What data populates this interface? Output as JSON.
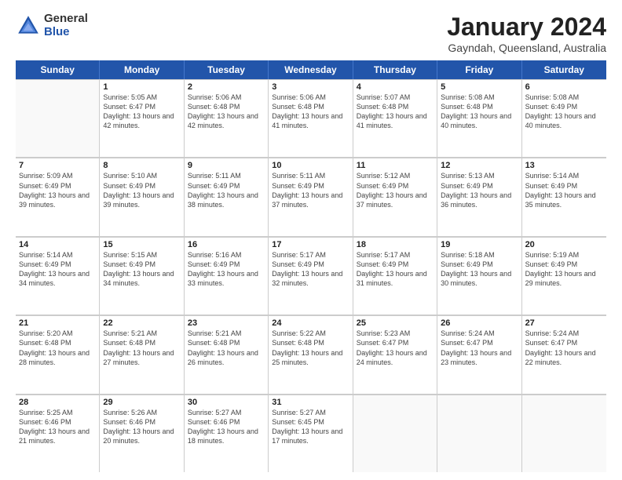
{
  "logo": {
    "general": "General",
    "blue": "Blue"
  },
  "header": {
    "title": "January 2024",
    "subtitle": "Gayndah, Queensland, Australia"
  },
  "days_of_week": [
    "Sunday",
    "Monday",
    "Tuesday",
    "Wednesday",
    "Thursday",
    "Friday",
    "Saturday"
  ],
  "weeks": [
    [
      {
        "day": "",
        "empty": true
      },
      {
        "day": "1",
        "sunrise": "Sunrise: 5:05 AM",
        "sunset": "Sunset: 6:47 PM",
        "daylight": "Daylight: 13 hours and 42 minutes."
      },
      {
        "day": "2",
        "sunrise": "Sunrise: 5:06 AM",
        "sunset": "Sunset: 6:48 PM",
        "daylight": "Daylight: 13 hours and 42 minutes."
      },
      {
        "day": "3",
        "sunrise": "Sunrise: 5:06 AM",
        "sunset": "Sunset: 6:48 PM",
        "daylight": "Daylight: 13 hours and 41 minutes."
      },
      {
        "day": "4",
        "sunrise": "Sunrise: 5:07 AM",
        "sunset": "Sunset: 6:48 PM",
        "daylight": "Daylight: 13 hours and 41 minutes."
      },
      {
        "day": "5",
        "sunrise": "Sunrise: 5:08 AM",
        "sunset": "Sunset: 6:48 PM",
        "daylight": "Daylight: 13 hours and 40 minutes."
      },
      {
        "day": "6",
        "sunrise": "Sunrise: 5:08 AM",
        "sunset": "Sunset: 6:49 PM",
        "daylight": "Daylight: 13 hours and 40 minutes."
      }
    ],
    [
      {
        "day": "7",
        "sunrise": "Sunrise: 5:09 AM",
        "sunset": "Sunset: 6:49 PM",
        "daylight": "Daylight: 13 hours and 39 minutes."
      },
      {
        "day": "8",
        "sunrise": "Sunrise: 5:10 AM",
        "sunset": "Sunset: 6:49 PM",
        "daylight": "Daylight: 13 hours and 39 minutes."
      },
      {
        "day": "9",
        "sunrise": "Sunrise: 5:11 AM",
        "sunset": "Sunset: 6:49 PM",
        "daylight": "Daylight: 13 hours and 38 minutes."
      },
      {
        "day": "10",
        "sunrise": "Sunrise: 5:11 AM",
        "sunset": "Sunset: 6:49 PM",
        "daylight": "Daylight: 13 hours and 37 minutes."
      },
      {
        "day": "11",
        "sunrise": "Sunrise: 5:12 AM",
        "sunset": "Sunset: 6:49 PM",
        "daylight": "Daylight: 13 hours and 37 minutes."
      },
      {
        "day": "12",
        "sunrise": "Sunrise: 5:13 AM",
        "sunset": "Sunset: 6:49 PM",
        "daylight": "Daylight: 13 hours and 36 minutes."
      },
      {
        "day": "13",
        "sunrise": "Sunrise: 5:14 AM",
        "sunset": "Sunset: 6:49 PM",
        "daylight": "Daylight: 13 hours and 35 minutes."
      }
    ],
    [
      {
        "day": "14",
        "sunrise": "Sunrise: 5:14 AM",
        "sunset": "Sunset: 6:49 PM",
        "daylight": "Daylight: 13 hours and 34 minutes."
      },
      {
        "day": "15",
        "sunrise": "Sunrise: 5:15 AM",
        "sunset": "Sunset: 6:49 PM",
        "daylight": "Daylight: 13 hours and 34 minutes."
      },
      {
        "day": "16",
        "sunrise": "Sunrise: 5:16 AM",
        "sunset": "Sunset: 6:49 PM",
        "daylight": "Daylight: 13 hours and 33 minutes."
      },
      {
        "day": "17",
        "sunrise": "Sunrise: 5:17 AM",
        "sunset": "Sunset: 6:49 PM",
        "daylight": "Daylight: 13 hours and 32 minutes."
      },
      {
        "day": "18",
        "sunrise": "Sunrise: 5:17 AM",
        "sunset": "Sunset: 6:49 PM",
        "daylight": "Daylight: 13 hours and 31 minutes."
      },
      {
        "day": "19",
        "sunrise": "Sunrise: 5:18 AM",
        "sunset": "Sunset: 6:49 PM",
        "daylight": "Daylight: 13 hours and 30 minutes."
      },
      {
        "day": "20",
        "sunrise": "Sunrise: 5:19 AM",
        "sunset": "Sunset: 6:49 PM",
        "daylight": "Daylight: 13 hours and 29 minutes."
      }
    ],
    [
      {
        "day": "21",
        "sunrise": "Sunrise: 5:20 AM",
        "sunset": "Sunset: 6:48 PM",
        "daylight": "Daylight: 13 hours and 28 minutes."
      },
      {
        "day": "22",
        "sunrise": "Sunrise: 5:21 AM",
        "sunset": "Sunset: 6:48 PM",
        "daylight": "Daylight: 13 hours and 27 minutes."
      },
      {
        "day": "23",
        "sunrise": "Sunrise: 5:21 AM",
        "sunset": "Sunset: 6:48 PM",
        "daylight": "Daylight: 13 hours and 26 minutes."
      },
      {
        "day": "24",
        "sunrise": "Sunrise: 5:22 AM",
        "sunset": "Sunset: 6:48 PM",
        "daylight": "Daylight: 13 hours and 25 minutes."
      },
      {
        "day": "25",
        "sunrise": "Sunrise: 5:23 AM",
        "sunset": "Sunset: 6:47 PM",
        "daylight": "Daylight: 13 hours and 24 minutes."
      },
      {
        "day": "26",
        "sunrise": "Sunrise: 5:24 AM",
        "sunset": "Sunset: 6:47 PM",
        "daylight": "Daylight: 13 hours and 23 minutes."
      },
      {
        "day": "27",
        "sunrise": "Sunrise: 5:24 AM",
        "sunset": "Sunset: 6:47 PM",
        "daylight": "Daylight: 13 hours and 22 minutes."
      }
    ],
    [
      {
        "day": "28",
        "sunrise": "Sunrise: 5:25 AM",
        "sunset": "Sunset: 6:46 PM",
        "daylight": "Daylight: 13 hours and 21 minutes."
      },
      {
        "day": "29",
        "sunrise": "Sunrise: 5:26 AM",
        "sunset": "Sunset: 6:46 PM",
        "daylight": "Daylight: 13 hours and 20 minutes."
      },
      {
        "day": "30",
        "sunrise": "Sunrise: 5:27 AM",
        "sunset": "Sunset: 6:46 PM",
        "daylight": "Daylight: 13 hours and 18 minutes."
      },
      {
        "day": "31",
        "sunrise": "Sunrise: 5:27 AM",
        "sunset": "Sunset: 6:45 PM",
        "daylight": "Daylight: 13 hours and 17 minutes."
      },
      {
        "day": "",
        "empty": true
      },
      {
        "day": "",
        "empty": true
      },
      {
        "day": "",
        "empty": true
      }
    ]
  ]
}
